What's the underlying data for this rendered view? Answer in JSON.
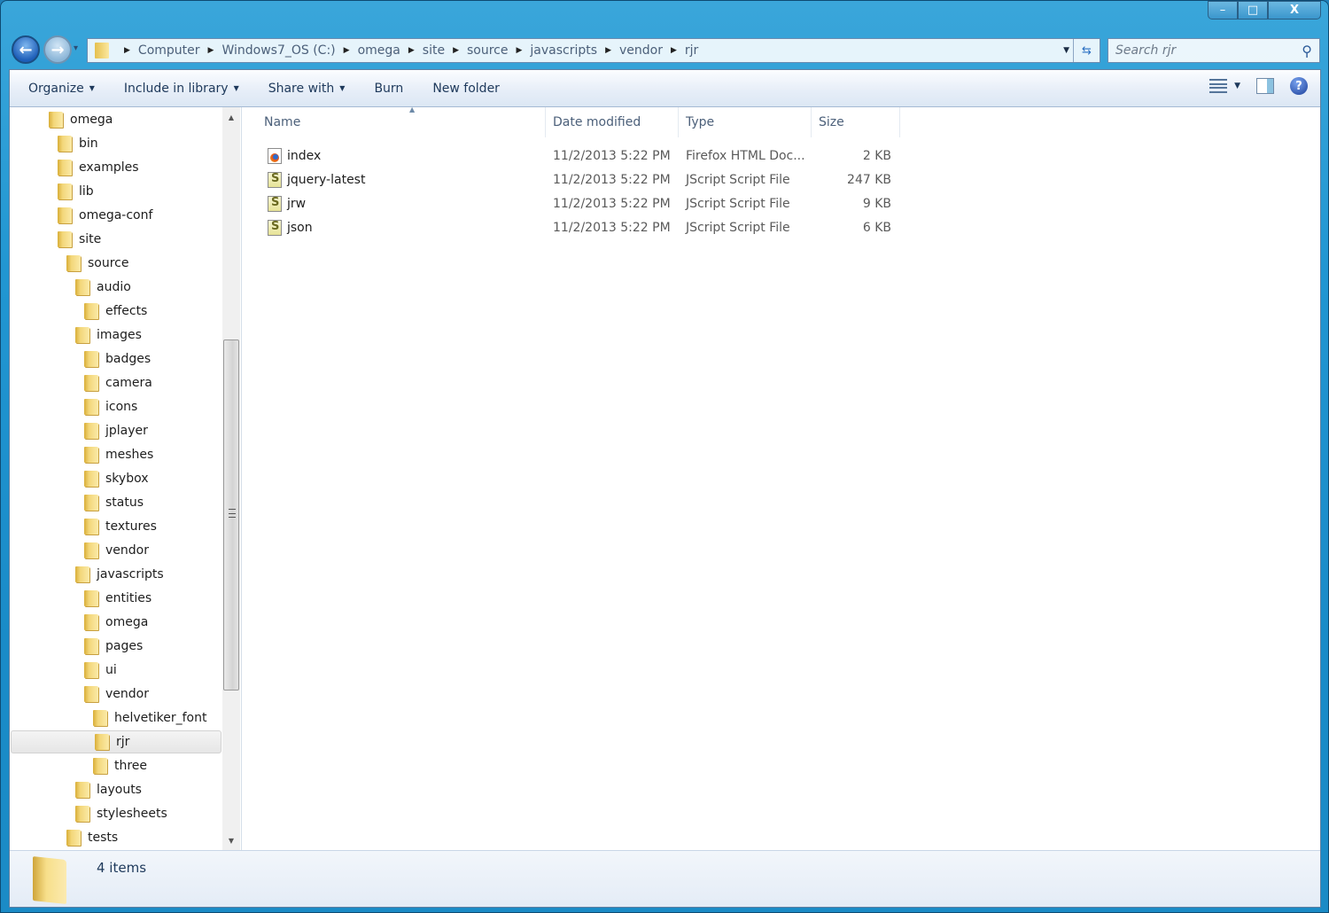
{
  "window": {
    "minimize_label": "–",
    "maximize_label": "□",
    "close_label": "X"
  },
  "nav": {
    "back_icon": "←",
    "forward_icon": "→",
    "recent_icon": "▾"
  },
  "address": {
    "crumbs": [
      "Computer",
      "Windows7_OS (C:)",
      "omega",
      "site",
      "source",
      "javascripts",
      "vendor",
      "rjr"
    ],
    "separator": "▶",
    "dropdown_icon": "▼",
    "refresh_icon": "⇆"
  },
  "search": {
    "placeholder": "Search rjr",
    "icon": "⚲"
  },
  "toolbar": {
    "organize": "Organize",
    "include_library": "Include in library",
    "share_with": "Share with",
    "burn": "Burn",
    "new_folder": "New folder",
    "dropdown_arrow": "▼",
    "help": "?"
  },
  "tree": {
    "items": [
      {
        "label": "omega",
        "depth": 0
      },
      {
        "label": "bin",
        "depth": 1
      },
      {
        "label": "examples",
        "depth": 1
      },
      {
        "label": "lib",
        "depth": 1
      },
      {
        "label": "omega-conf",
        "depth": 1
      },
      {
        "label": "site",
        "depth": 1
      },
      {
        "label": "source",
        "depth": 2
      },
      {
        "label": "audio",
        "depth": 3
      },
      {
        "label": "effects",
        "depth": 4
      },
      {
        "label": "images",
        "depth": 3
      },
      {
        "label": "badges",
        "depth": 4
      },
      {
        "label": "camera",
        "depth": 4
      },
      {
        "label": "icons",
        "depth": 4
      },
      {
        "label": "jplayer",
        "depth": 4
      },
      {
        "label": "meshes",
        "depth": 4
      },
      {
        "label": "skybox",
        "depth": 4
      },
      {
        "label": "status",
        "depth": 4
      },
      {
        "label": "textures",
        "depth": 4
      },
      {
        "label": "vendor",
        "depth": 4
      },
      {
        "label": "javascripts",
        "depth": 3
      },
      {
        "label": "entities",
        "depth": 4
      },
      {
        "label": "omega",
        "depth": 4
      },
      {
        "label": "pages",
        "depth": 4
      },
      {
        "label": "ui",
        "depth": 4
      },
      {
        "label": "vendor",
        "depth": 4
      },
      {
        "label": "helvetiker_font",
        "depth": 5
      },
      {
        "label": "rjr",
        "depth": 5,
        "selected": true
      },
      {
        "label": "three",
        "depth": 5
      },
      {
        "label": "layouts",
        "depth": 3
      },
      {
        "label": "stylesheets",
        "depth": 3
      },
      {
        "label": "tests",
        "depth": 2
      }
    ],
    "scroll_up": "▲",
    "scroll_down": "▼"
  },
  "columns": {
    "name": "Name",
    "date": "Date modified",
    "type": "Type",
    "size": "Size",
    "sort_indicator": "▲"
  },
  "files": [
    {
      "name": "index",
      "date": "11/2/2013 5:22 PM",
      "type": "Firefox HTML Doc...",
      "size": "2 KB",
      "icon": "firefox-html"
    },
    {
      "name": "jquery-latest",
      "date": "11/2/2013 5:22 PM",
      "type": "JScript Script File",
      "size": "247 KB",
      "icon": "jscript"
    },
    {
      "name": "jrw",
      "date": "11/2/2013 5:22 PM",
      "type": "JScript Script File",
      "size": "9 KB",
      "icon": "jscript"
    },
    {
      "name": "json",
      "date": "11/2/2013 5:22 PM",
      "type": "JScript Script File",
      "size": "6 KB",
      "icon": "jscript"
    }
  ],
  "status": {
    "count": "4 items"
  }
}
